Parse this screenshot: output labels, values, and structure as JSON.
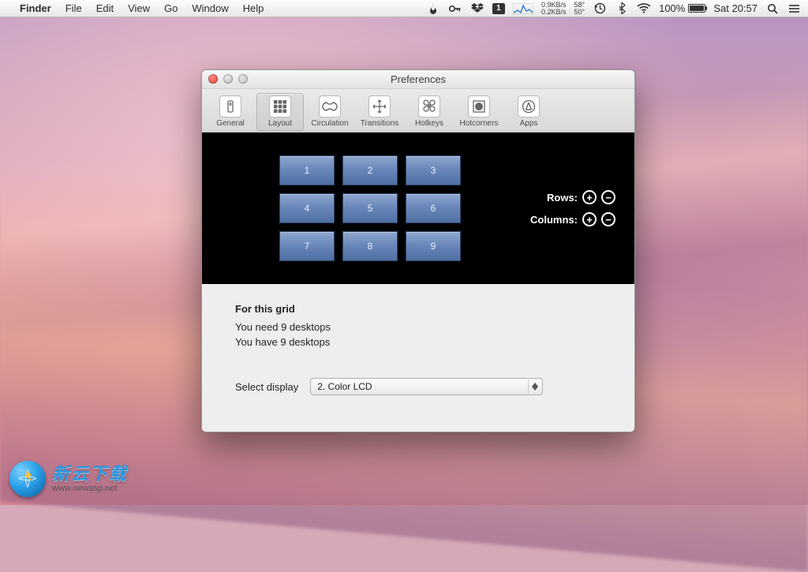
{
  "menubar": {
    "app_name": "Finder",
    "items": [
      "File",
      "Edit",
      "View",
      "Go",
      "Window",
      "Help"
    ],
    "net": {
      "down": "0.9KB/s",
      "up": "0.2KB/s"
    },
    "temps": {
      "a": "58°",
      "b": "50°"
    },
    "battery_pct": "100%",
    "clock": "Sat 20:57"
  },
  "window": {
    "title": "Preferences",
    "toolbar": [
      {
        "id": "general",
        "label": "General"
      },
      {
        "id": "layout",
        "label": "Layout"
      },
      {
        "id": "circulation",
        "label": "Circulation"
      },
      {
        "id": "transitions",
        "label": "Transitions"
      },
      {
        "id": "hotkeys",
        "label": "Hotkeys"
      },
      {
        "id": "hotcorners",
        "label": "Hotcorners"
      },
      {
        "id": "apps",
        "label": "Apps"
      }
    ],
    "selected_tool": "layout",
    "grid_cells": [
      "1",
      "2",
      "3",
      "4",
      "5",
      "6",
      "7",
      "8",
      "9"
    ],
    "controls": {
      "rows_label": "Rows:",
      "cols_label": "Columns:"
    },
    "status": {
      "header": "For this grid",
      "need": "You need 9 desktops",
      "have": "You have 9 desktops"
    },
    "display": {
      "label": "Select display",
      "selected": "2. Color LCD"
    }
  },
  "watermark": {
    "zh": "新云下载",
    "url": "www.newasp.net"
  }
}
